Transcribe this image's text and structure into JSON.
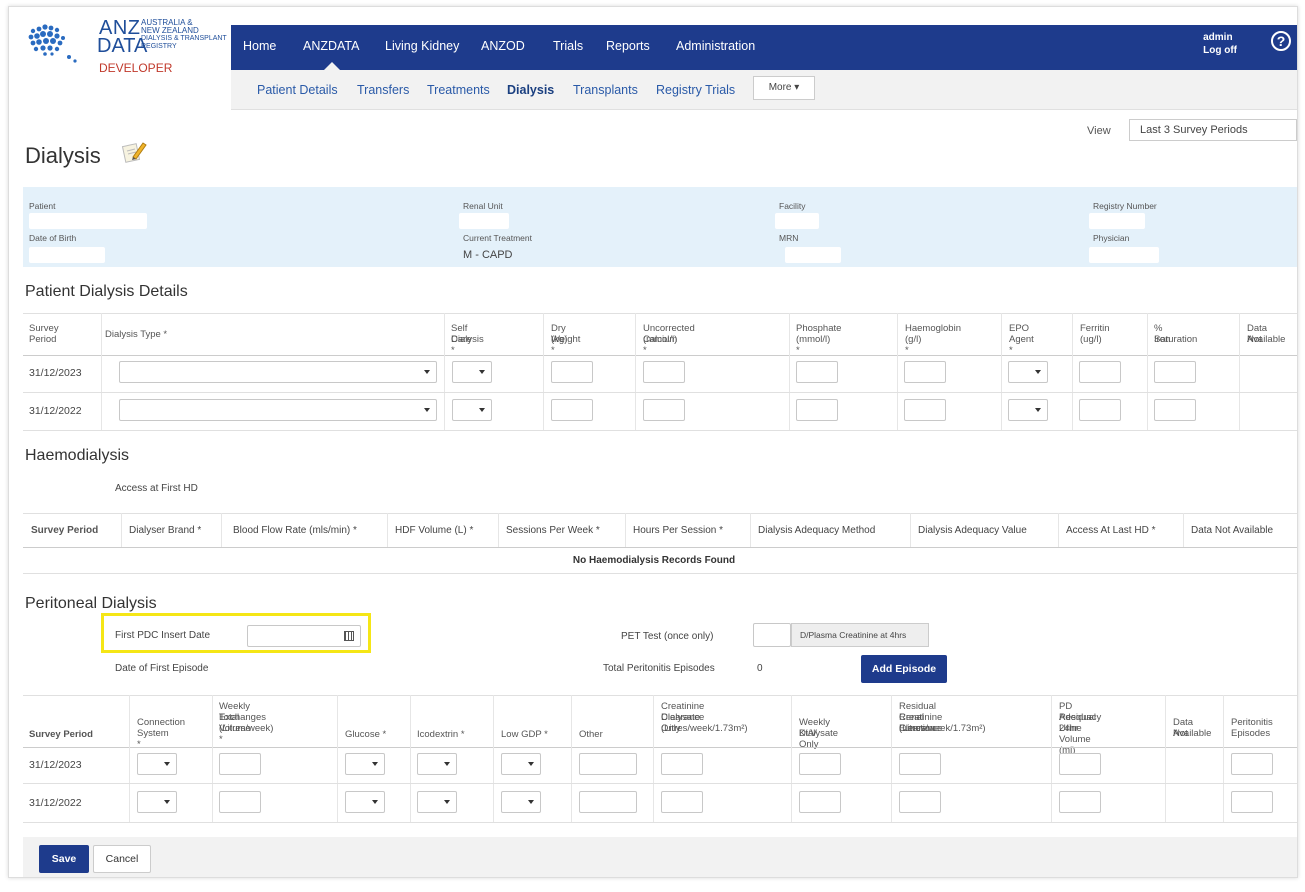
{
  "logo": {
    "brand_anz": "ANZ",
    "brand_data": "DATA",
    "sub_line1": "AUSTRALIA &",
    "sub_line2": "NEW ZEALAND",
    "sub_line3": "DIALYSIS & TRANSPLANT",
    "sub_line4": "REGISTRY",
    "environment": "DEVELOPER"
  },
  "topnav": {
    "items": [
      "Home",
      "ANZDATA",
      "Living Kidney",
      "ANZOD",
      "Trials",
      "Reports",
      "Administration"
    ],
    "active": "ANZDATA",
    "user": "admin",
    "logoff": "Log off",
    "help": "?"
  },
  "subnav": {
    "items": [
      "Patient Details",
      "Transfers",
      "Treatments",
      "Dialysis",
      "Transplants",
      "Registry Trials"
    ],
    "active": "Dialysis",
    "more": "More ▾"
  },
  "page": {
    "title": "Dialysis",
    "view_label": "View",
    "view_value": "Last 3 Survey Periods"
  },
  "patient_info": {
    "patient_label": "Patient",
    "renal_unit_label": "Renal Unit",
    "facility_label": "Facility",
    "registry_number_label": "Registry Number",
    "dob_label": "Date of Birth",
    "current_treatment_label": "Current Treatment",
    "current_treatment_value": "M - CAPD",
    "mrn_label": "MRN",
    "physician_label": "Physician"
  },
  "patient_dialysis": {
    "heading": "Patient Dialysis Details",
    "columns": {
      "survey_period_1": "Survey",
      "survey_period_2": "Period",
      "dialysis_type": "Dialysis Type *",
      "self_care_1": "Self Care",
      "self_care_2": "Dialysis *",
      "dry_weight_1": "Dry Weight",
      "dry_weight_2": "(kg) *",
      "calcium_1": "Uncorrected Calcium",
      "calcium_2": "(mmol/l) *",
      "phosphate_1": "Phosphate",
      "phosphate_2": "(mmol/l) *",
      "haemoglobin_1": "Haemoglobin",
      "haemoglobin_2": "(g/l) *",
      "epo_1": "EPO",
      "epo_2": "Agent *",
      "ferritin_1": "Ferritin",
      "ferritin_2": "(ug/l)",
      "saturation_1": "% Saturation",
      "saturation_2": "Iron",
      "dna_1": "Data Not",
      "dna_2": "Available"
    },
    "rows": [
      {
        "period": "31/12/2023"
      },
      {
        "period": "31/12/2022"
      }
    ]
  },
  "haemodialysis": {
    "heading": "Haemodialysis",
    "access_first_hd": "Access at First HD",
    "columns": [
      "Survey Period",
      "Dialyser Brand *",
      "Blood Flow Rate (mls/min) *",
      "HDF Volume (L) *",
      "Sessions Per Week *",
      "Hours Per Session *",
      "Dialysis Adequacy Method",
      "Dialysis Adequacy Value",
      "Access At Last HD *",
      "Data Not Available"
    ],
    "empty": "No Haemodialysis Records Found"
  },
  "peritoneal": {
    "heading": "Peritoneal Dialysis",
    "first_pdc_label": "First PDC Insert Date",
    "first_episode_label": "Date of First Episode",
    "pet_label": "PET Test (once only)",
    "pet_suffix": "D/Plasma Creatinine at 4hrs",
    "total_episodes_label": "Total Peritonitis Episodes",
    "total_episodes_value": "0",
    "add_episode": "Add Episode",
    "columns": {
      "survey_period": "Survey Period",
      "connection_1": "Connection",
      "connection_2": "System *",
      "weekly_1": "Weekly Exchanges",
      "weekly_2": "Total Volume",
      "weekly_3": "(Litres/week) *",
      "glucose": "Glucose *",
      "icodextrin": "Icodextrin *",
      "low_gdp": "Low GDP *",
      "other": "Other",
      "cc_1": "Creatinine Clearance",
      "cc_2": "Dialysate Only",
      "cc_3": "(Litres/week/1.73m²)",
      "ktv_1": "Weekly Kt/V",
      "ktv_2": "Dialysate Only",
      "rrf_1": "Residual Renal Function",
      "rrf_2": "Creatinine Clearance",
      "rrf_3": "(Litres/week/1.73m²)",
      "pda_1": "PD Adequacy",
      "pda_2": "Residual Urine",
      "pda_3": "24hr Volume (ml)",
      "dna_1": "Data Not",
      "dna_2": "Available",
      "pe_1": "Peritonitis",
      "pe_2": "Episodes"
    },
    "rows": [
      {
        "period": "31/12/2023"
      },
      {
        "period": "31/12/2022"
      }
    ]
  },
  "footer": {
    "save": "Save",
    "cancel": "Cancel"
  },
  "colors": {
    "nav_blue": "#1e3b8c",
    "info_band": "#e4f1fa",
    "highlight": "#f5e616",
    "developer_red": "#c0392b"
  }
}
